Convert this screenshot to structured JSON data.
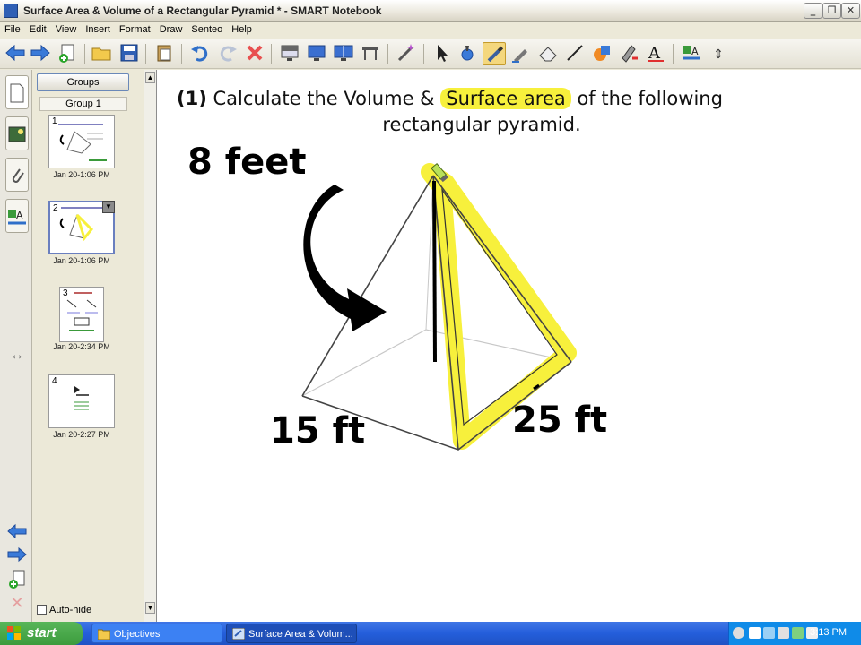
{
  "window": {
    "title": "Surface Area & Volume of a Rectangular Pyramid * - SMART Notebook",
    "minimize_glyph": "_",
    "maximize_glyph": "❐",
    "close_glyph": "✕"
  },
  "menu": [
    "File",
    "Edit",
    "View",
    "Insert",
    "Format",
    "Draw",
    "Senteo",
    "Help"
  ],
  "toolbar_icons": [
    "back-arrow-icon",
    "forward-arrow-icon",
    "add-page-icon",
    "open-folder-icon",
    "save-icon",
    "paste-icon",
    "undo-icon",
    "redo-icon",
    "delete-icon",
    "screen-shade-icon",
    "full-screen-icon",
    "dual-display-icon",
    "table-icon",
    "magic-pen-icon",
    "select-arrow-icon",
    "pen-icon",
    "highlighter-icon",
    "creative-pen-icon",
    "eraser-icon",
    "line-icon",
    "shapes-icon",
    "fill-icon",
    "text-icon",
    "properties-icon",
    "move-toolbar-icon"
  ],
  "sorter": {
    "groups_button": "Groups",
    "group_label": "Group 1",
    "pages": [
      {
        "num": "1",
        "date": "Jan 20-1:06 PM"
      },
      {
        "num": "2",
        "date": "Jan 20-1:06 PM"
      },
      {
        "num": "3",
        "date": "Jan 20-2:34 PM"
      },
      {
        "num": "4",
        "date": "Jan 20-2:27 PM"
      }
    ],
    "autohide_label": "Auto-hide"
  },
  "page": {
    "question_number": "(1)",
    "question_pre": "Calculate the Volume &",
    "question_highlight": "Surface area",
    "question_post": "of the following",
    "question_line2": "rectangular pyramid.",
    "height_label": "8 feet",
    "base_width_label": "15 ft",
    "base_depth_label": "25 ft",
    "highlight_color": "#f7f03c"
  },
  "taskbar": {
    "start_label": "start",
    "tasks": [
      {
        "label": "Objectives"
      },
      {
        "label": "Surface Area & Volum..."
      }
    ],
    "clock": "3:13 PM"
  }
}
